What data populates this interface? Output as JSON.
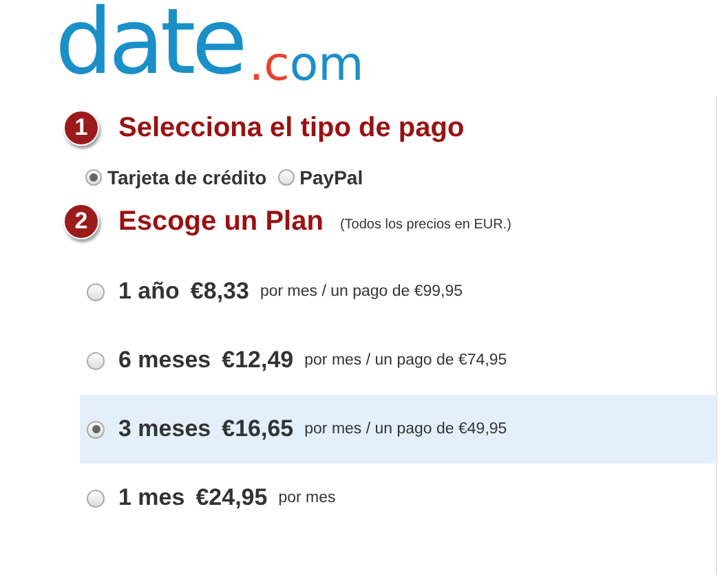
{
  "logo": {
    "name": "date",
    "suffix": ".com"
  },
  "steps": [
    {
      "number": "1",
      "title": "Selecciona el tipo de pago",
      "options": [
        {
          "label": "Tarjeta de crédito",
          "selected": true
        },
        {
          "label": "PayPal",
          "selected": false
        }
      ]
    },
    {
      "number": "2",
      "title": "Escoge un Plan",
      "note": "(Todos los precios en EUR.)",
      "plans": [
        {
          "term": "1 año",
          "price": "€8,33",
          "detail": "por mes / un pago de €99,95",
          "selected": false
        },
        {
          "term": "6 meses",
          "price": "€12,49",
          "detail": "por mes / un pago de €74,95",
          "selected": false
        },
        {
          "term": "3 meses",
          "price": "€16,65",
          "detail": "por mes / un pago de €49,95",
          "selected": true
        },
        {
          "term": "1 mes",
          "price": "€24,95",
          "detail": "por mes",
          "selected": false
        }
      ]
    }
  ]
}
